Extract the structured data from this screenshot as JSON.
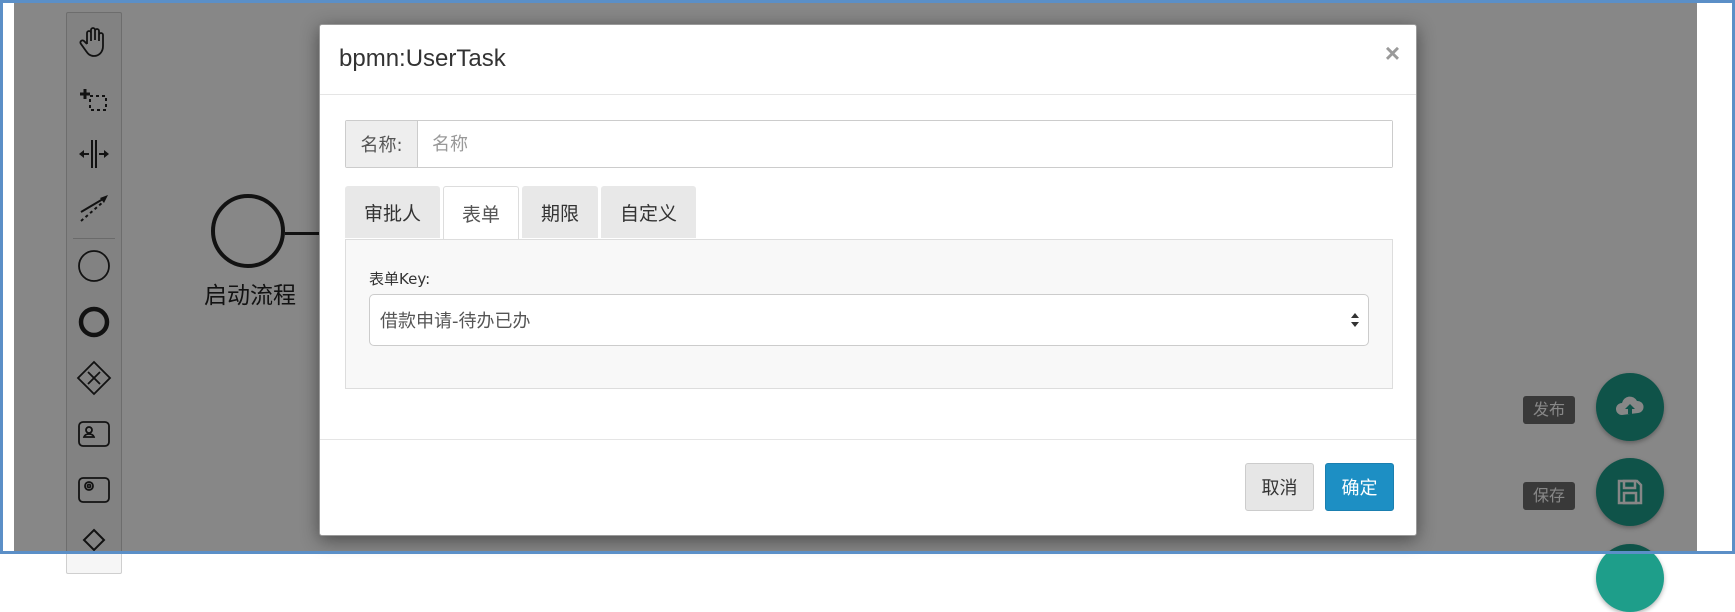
{
  "canvas": {
    "start_event_label": "启动流程",
    "palette_tools": [
      "hand-tool-icon",
      "lasso-tool-icon",
      "space-tool-icon",
      "connect-tool-icon",
      "start-event-icon",
      "end-event-icon",
      "gateway-icon",
      "user-task-icon",
      "service-task-icon"
    ],
    "publish_label": "发布",
    "save_label": "保存"
  },
  "modal": {
    "title": "bpmn:UserTask",
    "close_symbol": "×",
    "name_label": "名称:",
    "name_value": "",
    "name_placeholder": "名称",
    "tabs": [
      {
        "label": "审批人",
        "active": false
      },
      {
        "label": "表单",
        "active": true
      },
      {
        "label": "期限",
        "active": false
      },
      {
        "label": "自定义",
        "active": false
      }
    ],
    "form_key_label": "表单Key:",
    "form_key_value": "借款申请-待办已办",
    "cancel_label": "取消",
    "ok_label": "确定"
  },
  "colors": {
    "accent": "#1d8fc4",
    "fab": "#1e9e8a",
    "frame": "#5b8fc7"
  }
}
